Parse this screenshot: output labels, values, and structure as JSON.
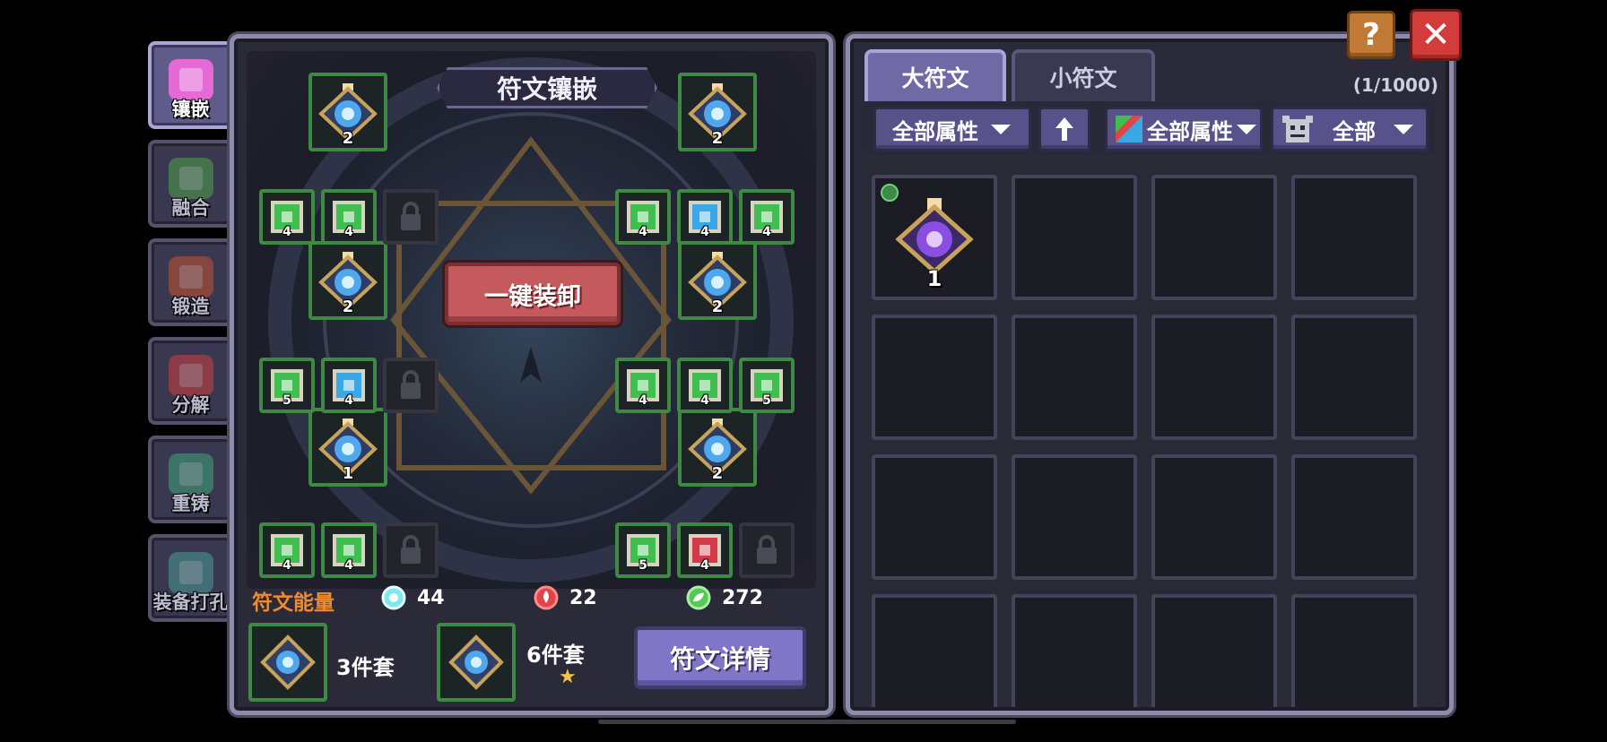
{
  "side_tabs": [
    {
      "label": "镶嵌",
      "active": true,
      "icon": "inlay-icon",
      "color": "#e56ad6"
    },
    {
      "label": "融合",
      "active": false,
      "icon": "fusion-icon",
      "color": "#4ea54a"
    },
    {
      "label": "锻造",
      "active": false,
      "icon": "forge-icon",
      "color": "#c4502e"
    },
    {
      "label": "分解",
      "active": false,
      "icon": "decompose-icon",
      "color": "#d04040"
    },
    {
      "label": "重铸",
      "active": false,
      "icon": "recast-icon",
      "color": "#3fa67c"
    },
    {
      "label": "装备打孔",
      "active": false,
      "icon": "socket-icon",
      "color": "#4a9c97"
    }
  ],
  "board": {
    "title": "符文镶嵌",
    "unequip_label": "一键装卸",
    "big_runes": [
      {
        "level": "2",
        "icon": "big-rune-icon"
      },
      {
        "level": "2",
        "icon": "big-rune-icon"
      },
      {
        "level": "2",
        "icon": "big-rune-icon"
      },
      {
        "level": "2",
        "icon": "big-rune-icon"
      },
      {
        "level": "1",
        "icon": "big-rune-icon"
      },
      {
        "level": "2",
        "icon": "big-rune-icon"
      }
    ],
    "small_runes": [
      {
        "level": "4",
        "color": "#3fbf4f",
        "locked": false
      },
      {
        "level": "4",
        "color": "#3fbf4f",
        "locked": false
      },
      {
        "level": "",
        "color": "",
        "locked": true
      },
      {
        "level": "4",
        "color": "#3fbf4f",
        "locked": false
      },
      {
        "level": "4",
        "color": "#3aa7e6",
        "locked": false
      },
      {
        "level": "4",
        "color": "#3fbf4f",
        "locked": false
      },
      {
        "level": "5",
        "color": "#3fbf4f",
        "locked": false
      },
      {
        "level": "4",
        "color": "#3aa7e6",
        "locked": false
      },
      {
        "level": "",
        "color": "",
        "locked": true
      },
      {
        "level": "4",
        "color": "#3fbf4f",
        "locked": false
      },
      {
        "level": "4",
        "color": "#3fbf4f",
        "locked": false
      },
      {
        "level": "5",
        "color": "#3fbf4f",
        "locked": false
      },
      {
        "level": "4",
        "color": "#3fbf4f",
        "locked": false
      },
      {
        "level": "4",
        "color": "#3fbf4f",
        "locked": false
      },
      {
        "level": "",
        "color": "",
        "locked": true
      },
      {
        "level": "5",
        "color": "#3fbf4f",
        "locked": false
      },
      {
        "level": "4",
        "color": "#d23a4a",
        "locked": false
      },
      {
        "level": "",
        "color": "",
        "locked": true
      }
    ]
  },
  "energy": {
    "label": "符文能量",
    "items": [
      {
        "value": "44",
        "icon": "cyan-energy-icon",
        "color": "#7fe8f0"
      },
      {
        "value": "22",
        "icon": "fire-energy-icon",
        "color": "#e0454a"
      },
      {
        "value": "272",
        "icon": "green-energy-icon",
        "color": "#56c85a"
      }
    ]
  },
  "sets": {
    "set1_label": "3件套",
    "set2_label": "6件套",
    "star": "★",
    "detail_button": "符文详情"
  },
  "right": {
    "tabs": [
      {
        "label": "大符文",
        "active": true
      },
      {
        "label": "小符文",
        "active": false
      }
    ],
    "count": "(1/1000)",
    "filters": {
      "attr1": "全部属性",
      "attr2": "全部属性",
      "all": "全部"
    },
    "inventory": [
      {
        "level": "1",
        "has_item": true,
        "new": true
      }
    ]
  },
  "colors": {
    "accent_purple": "#8076c8",
    "unequip_red": "#c45a5e",
    "close_red": "#d43c3c",
    "help_orange": "#c07a35",
    "slot_green": "#3e8a44"
  }
}
